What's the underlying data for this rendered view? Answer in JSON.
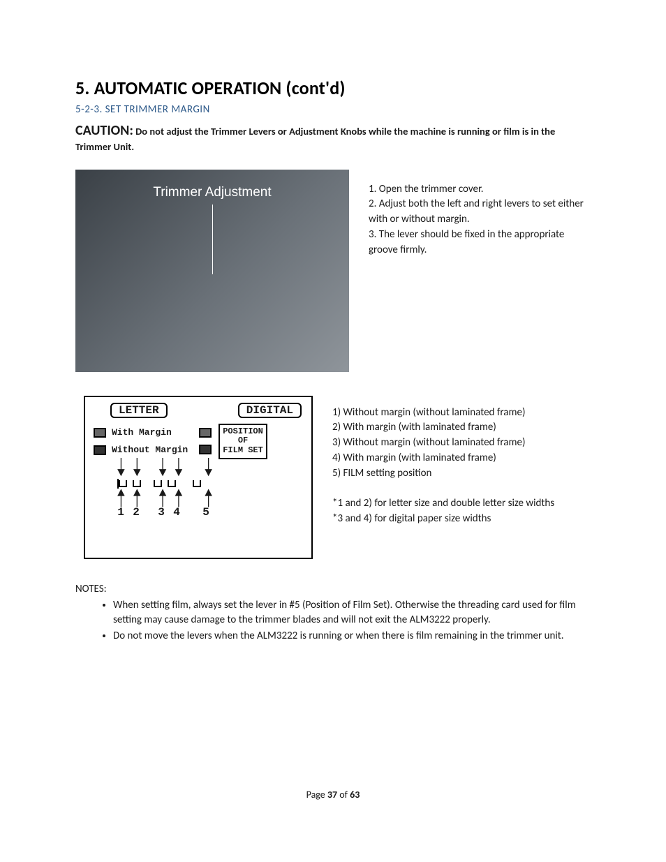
{
  "heading": "5. AUTOMATIC OPERATION (cont'd)",
  "subheading": "5-2-3. SET TRIMMER MARGIN",
  "caution": {
    "label": "CAUTION:",
    "text": "Do not adjust the Trimmer Levers or Adjustment Knobs while the machine is running or film is in the Trimmer Unit."
  },
  "photo_label": "Trimmer Adjustment",
  "steps": [
    "1. Open the trimmer cover.",
    "2. Adjust both the left and right levers to set either with or without margin.",
    "3. The lever should be fixed in the appropriate groove firmly."
  ],
  "diagram": {
    "pill_letter": "LETTER",
    "pill_digital": "DIGITAL",
    "with_margin": "With Margin",
    "without_margin": "Without Margin",
    "filmset_line1": "POSITION",
    "filmset_line2": "OF",
    "filmset_line3": "FILM SET",
    "numbers": [
      "1",
      "2",
      "3",
      "4",
      "5"
    ]
  },
  "margin_options": [
    "1) Without margin (without laminated frame)",
    "2) With margin (with laminated frame)",
    "3) Without margin (without laminated frame)",
    "4) With margin (with laminated frame)",
    "5) FILM setting position"
  ],
  "margin_footnotes": [
    "*1 and 2) for letter size and double letter size widths",
    "*3 and 4) for digital paper size widths"
  ],
  "notes_label": "NOTES:",
  "notes": [
    "When setting film, always set the lever in #5 (Position of Film Set). Otherwise the threading card used for film setting may cause damage to the trimmer blades and will not exit the ALM3222 properly.",
    "Do not move the levers when the ALM3222 is running or when there is film remaining in the trimmer unit."
  ],
  "footer": {
    "prefix": "Page ",
    "page": "37",
    "of": " of ",
    "total": "63"
  }
}
